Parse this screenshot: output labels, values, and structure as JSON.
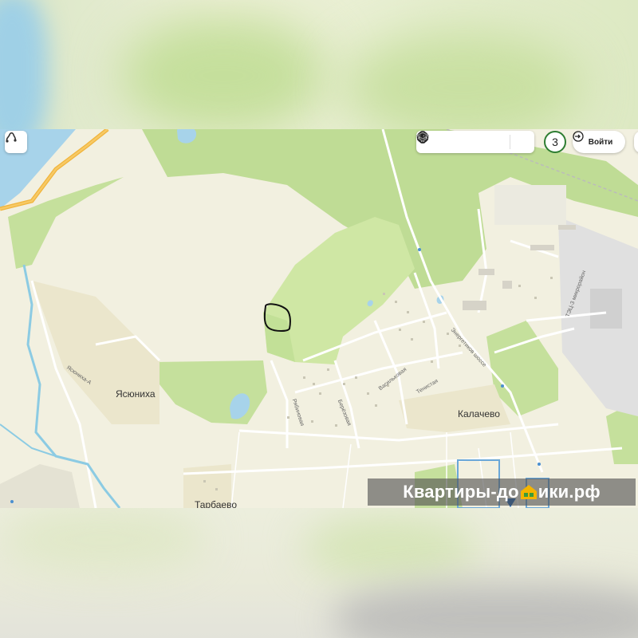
{
  "map": {
    "places": {
      "yasyunikha": "Ясюниха",
      "kalachevo": "Калачево",
      "tarbaevo": "Тарбаево"
    },
    "streets": {
      "yasyunikha_street": "Ясюниха-А",
      "energetikov": "Энергетиков шоссе",
      "tets3": "ТЭЦ-3 микрорайон",
      "ryabinovaya": "Рябиновая",
      "berezovaya": "Берёзовая",
      "vasilkovaya": "Васильковая",
      "tenistaya": "Тенистая"
    }
  },
  "controls": {
    "route_icon": "route-icon",
    "layer_icons": [
      "traffic-light-icon",
      "transit-icon",
      "parking-icon",
      "car-icon",
      "layers-icon"
    ],
    "user_badge": "3",
    "login_label": "Войти"
  },
  "watermark": {
    "text_left": "Квартиры-до",
    "text_right": "ики.рф"
  }
}
